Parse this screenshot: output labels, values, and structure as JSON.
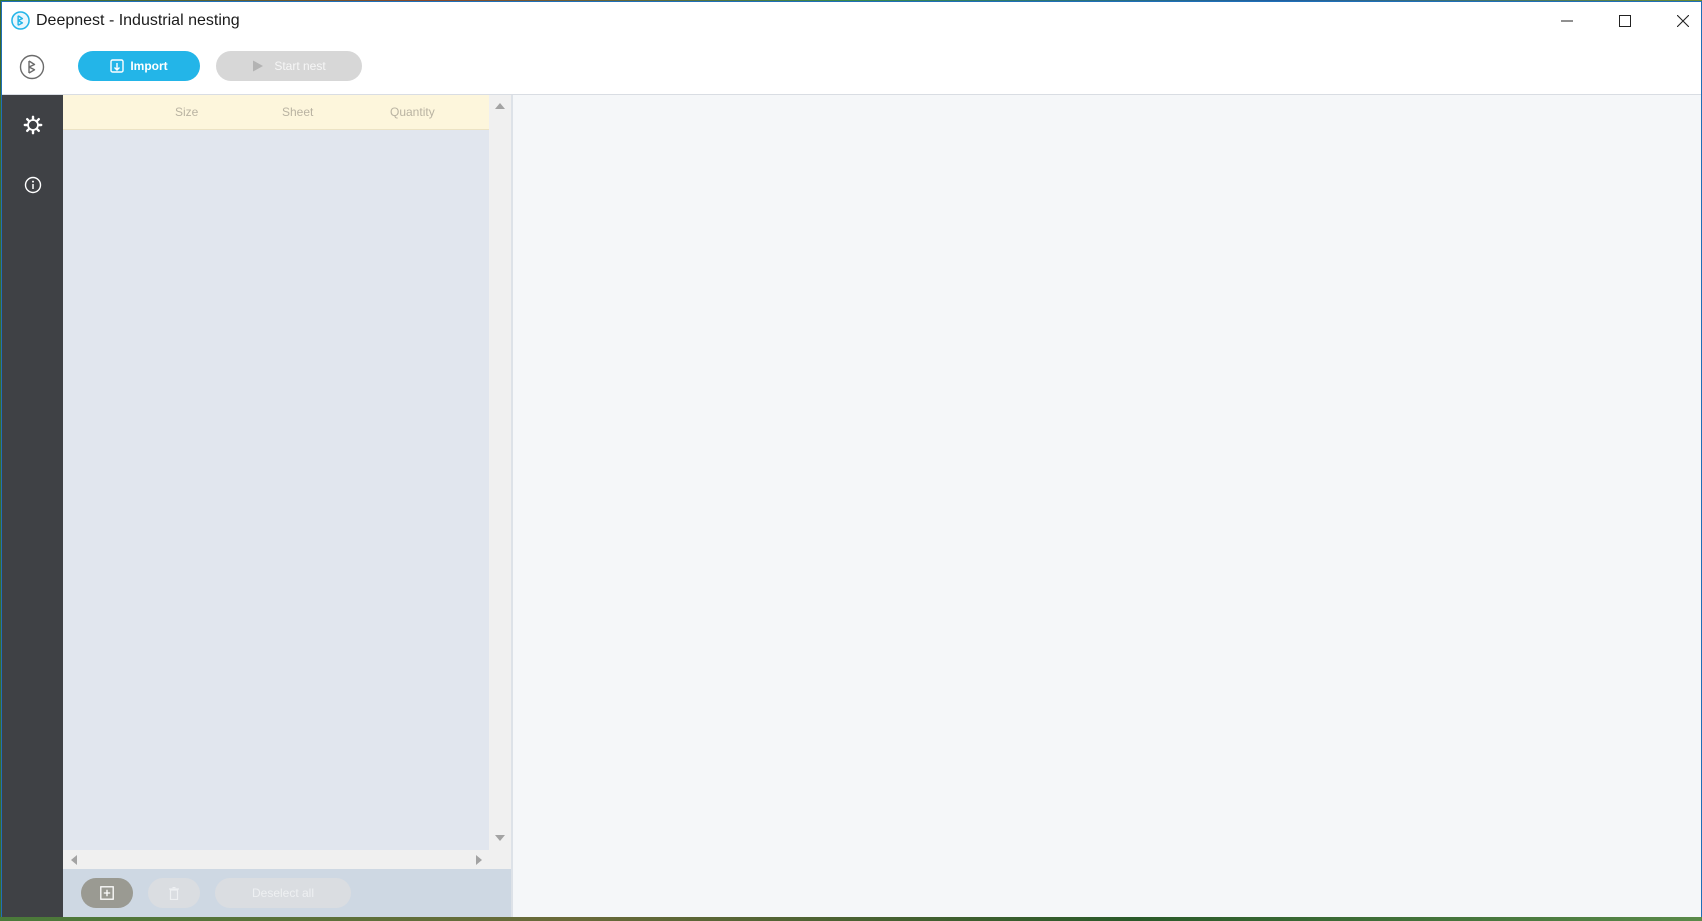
{
  "window": {
    "title": "Deepnest - Industrial nesting"
  },
  "toolbar": {
    "import_label": "Import",
    "start_nest_label": "Start nest"
  },
  "parts_table": {
    "columns": [
      "Size",
      "Sheet",
      "Quantity"
    ],
    "rows": []
  },
  "panel_footer": {
    "deselect_all_label": "Deselect all"
  },
  "icons": {
    "app": "deepnest-logo-icon",
    "import": "import-icon",
    "start": "play-icon",
    "settings": "gear-icon",
    "info": "info-icon",
    "add_sheet": "add-sheet-icon",
    "delete": "trash-icon"
  },
  "colors": {
    "accent": "#23b5e8",
    "sidebar": "#3f4145",
    "table_header": "#fdf6dc",
    "panel": "#e1e6ee"
  }
}
